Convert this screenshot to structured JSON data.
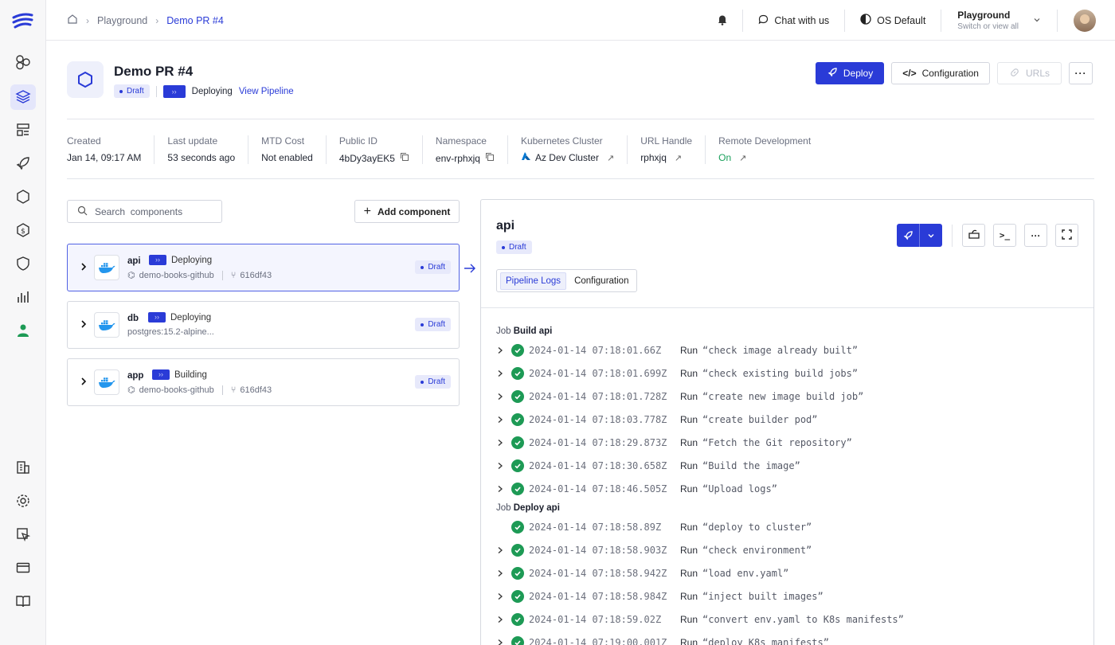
{
  "breadcrumb": {
    "items": [
      "Playground",
      "Demo PR #4"
    ]
  },
  "topbar": {
    "chat_label": "Chat with us",
    "theme_label": "OS Default",
    "workspace_name": "Playground",
    "workspace_sub": "Switch or view all"
  },
  "env": {
    "title": "Demo PR #4",
    "draft": "Draft",
    "status": "Deploying",
    "view_pipeline": "View Pipeline",
    "actions": {
      "deploy": "Deploy",
      "configuration": "Configuration",
      "urls": "URLs"
    },
    "meta": [
      {
        "label": "Created",
        "value": "Jan 14, 09:17 AM"
      },
      {
        "label": "Last update",
        "value": "53 seconds ago"
      },
      {
        "label": "MTD Cost",
        "value": "Not enabled"
      },
      {
        "label": "Public ID",
        "value": "4bDy3ayEK5"
      },
      {
        "label": "Namespace",
        "value": "env-rphxjq"
      },
      {
        "label": "Kubernetes Cluster",
        "value": "Az Dev Cluster"
      },
      {
        "label": "URL Handle",
        "value": "rphxjq"
      },
      {
        "label": "Remote Development",
        "value": "On"
      }
    ]
  },
  "components": {
    "search_placeholder": "Search  components",
    "add_label": "Add component",
    "items": [
      {
        "name": "api",
        "status": "Deploying",
        "repo": "demo-books-github",
        "commit": "616df43",
        "badge": "Draft"
      },
      {
        "name": "db",
        "status": "Deploying",
        "image": "postgres:15.2-alpine...",
        "badge": "Draft"
      },
      {
        "name": "app",
        "status": "Building",
        "repo": "demo-books-github",
        "commit": "616df43",
        "badge": "Draft"
      }
    ]
  },
  "detail": {
    "title": "api",
    "badge": "Draft",
    "tabs": [
      "Pipeline Logs",
      "Configuration"
    ],
    "jobs": [
      {
        "prefix": "Job",
        "name": "Build api"
      },
      {
        "prefix": "Job",
        "name": "Deploy api"
      }
    ],
    "run_label": "Run",
    "logs_build": [
      {
        "ts": "2024-01-14 07:18:01.66Z",
        "cmd": "“check image already built”"
      },
      {
        "ts": "2024-01-14 07:18:01.699Z",
        "cmd": "“check existing build jobs”"
      },
      {
        "ts": "2024-01-14 07:18:01.728Z",
        "cmd": "“create new image build job”"
      },
      {
        "ts": "2024-01-14 07:18:03.778Z",
        "cmd": "“create builder pod”"
      },
      {
        "ts": "2024-01-14 07:18:29.873Z",
        "cmd": "“Fetch the Git repository”"
      },
      {
        "ts": "2024-01-14 07:18:30.658Z",
        "cmd": "“Build the image”"
      },
      {
        "ts": "2024-01-14 07:18:46.505Z",
        "cmd": "“Upload logs”"
      }
    ],
    "logs_deploy": [
      {
        "ts": "2024-01-14 07:18:58.89Z",
        "cmd": "“deploy to cluster”"
      },
      {
        "ts": "2024-01-14 07:18:58.903Z",
        "cmd": "“check environment”"
      },
      {
        "ts": "2024-01-14 07:18:58.942Z",
        "cmd": "“load env.yaml”"
      },
      {
        "ts": "2024-01-14 07:18:58.984Z",
        "cmd": "“inject built images”"
      },
      {
        "ts": "2024-01-14 07:18:59.02Z",
        "cmd": "“convert env.yaml to K8s manifests”"
      },
      {
        "ts": "2024-01-14 07:19:00.001Z",
        "cmd": "“deploy K8s manifests”"
      }
    ]
  },
  "colors": {
    "accent": "#2a3bd7",
    "success": "#1d9a55",
    "sidebar_bg": "#f7f7f8"
  }
}
